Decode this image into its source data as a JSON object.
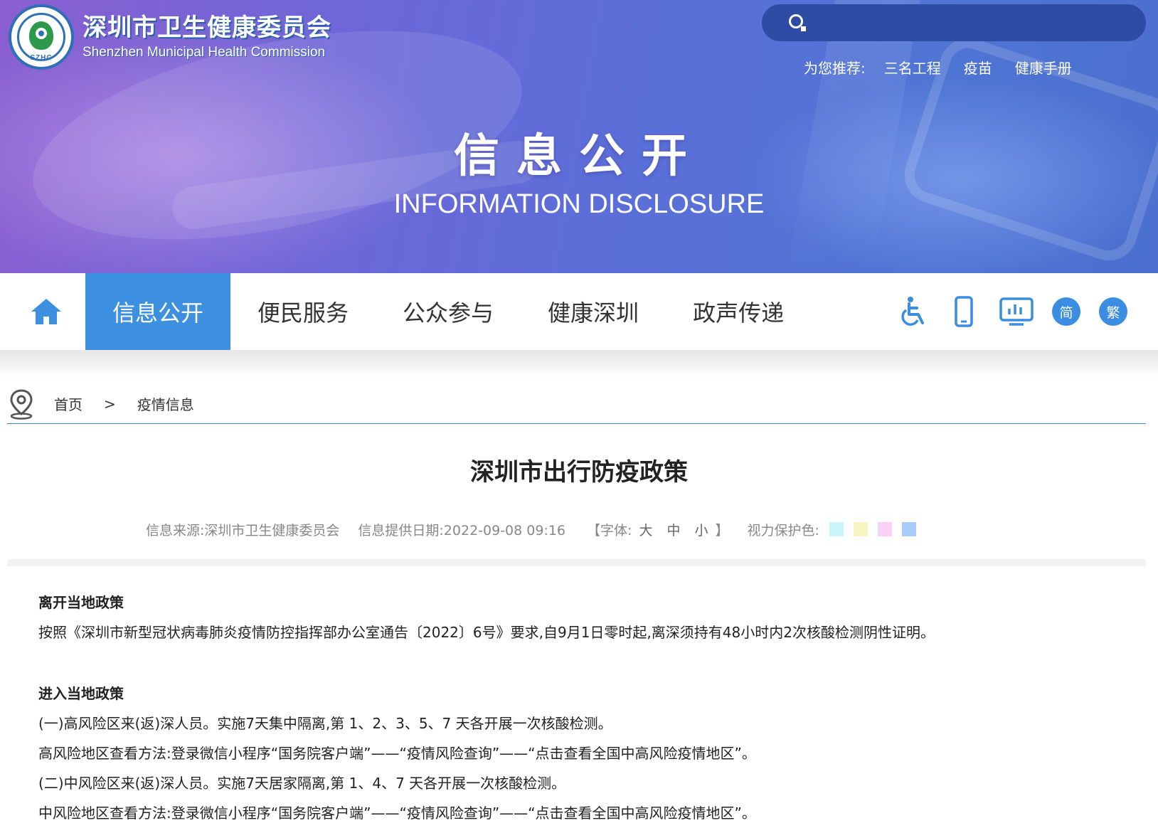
{
  "header": {
    "org_name_cn": "深圳市卫生健康委员会",
    "org_name_en": "Shenzhen Municipal Health Commission",
    "emblem_abbr": "SZHC",
    "search_placeholder": "",
    "recommend_label": "为您推荐:",
    "recommend_links": [
      "三名工程",
      "疫苗",
      "健康手册"
    ],
    "section_title_cn": "信息公开",
    "section_title_en": "INFORMATION DISCLOSURE"
  },
  "nav": {
    "items": [
      {
        "label": "信息公开",
        "active": true
      },
      {
        "label": "便民服务",
        "active": false
      },
      {
        "label": "公众参与",
        "active": false
      },
      {
        "label": "健康深圳",
        "active": false
      },
      {
        "label": "政声传递",
        "active": false
      }
    ],
    "tools": {
      "accessibility_icon": "wheelchair-icon",
      "mobile_icon": "mobile-phone-icon",
      "data_icon": "chart-icon",
      "simplified": "简",
      "traditional": "繁"
    },
    "active_color": "#3d8fe0"
  },
  "breadcrumb": {
    "home": "首页",
    "separator": ">",
    "current": "疫情信息"
  },
  "article": {
    "title": "深圳市出行防疫政策",
    "source": "信息来源:深圳市卫生健康委员会",
    "date": "信息提供日期:2022-09-08 09:16",
    "font_label": "【字体:",
    "font_large": "大",
    "font_medium": "中",
    "font_small": "小",
    "font_close": "】",
    "eye_care_label": "视力保护色:",
    "eye_care_colors": [
      "#c9f6fb",
      "#f8f6c0",
      "#f8d3f5",
      "#a9cdf8"
    ],
    "sections": [
      {
        "title": "离开当地政策",
        "paragraphs": [
          "按照《深圳市新型冠状病毒肺炎疫情防控指挥部办公室通告〔2022〕6号》要求,自9月1日零时起,离深须持有48小时内2次核酸检测阴性证明。"
        ]
      },
      {
        "title": "进入当地政策",
        "paragraphs": [
          "(一)高风险区来(返)深人员。实施7天集中隔离,第 1、2、3、5、7 天各开展一次核酸检测。",
          "高风险地区查看方法:登录微信小程序“国务院客户端”——“疫情风险查询”——“点击查看全国中高风险疫情地区”。",
          "(二)中风险区来(返)深人员。实施7天居家隔离,第 1、4、7 天各开展一次核酸检测。",
          "中风险地区查看方法:登录微信小程序“国务院客户端”——“疫情风险查询”——“点击查看全国中高风险疫情地区”。"
        ]
      }
    ]
  }
}
